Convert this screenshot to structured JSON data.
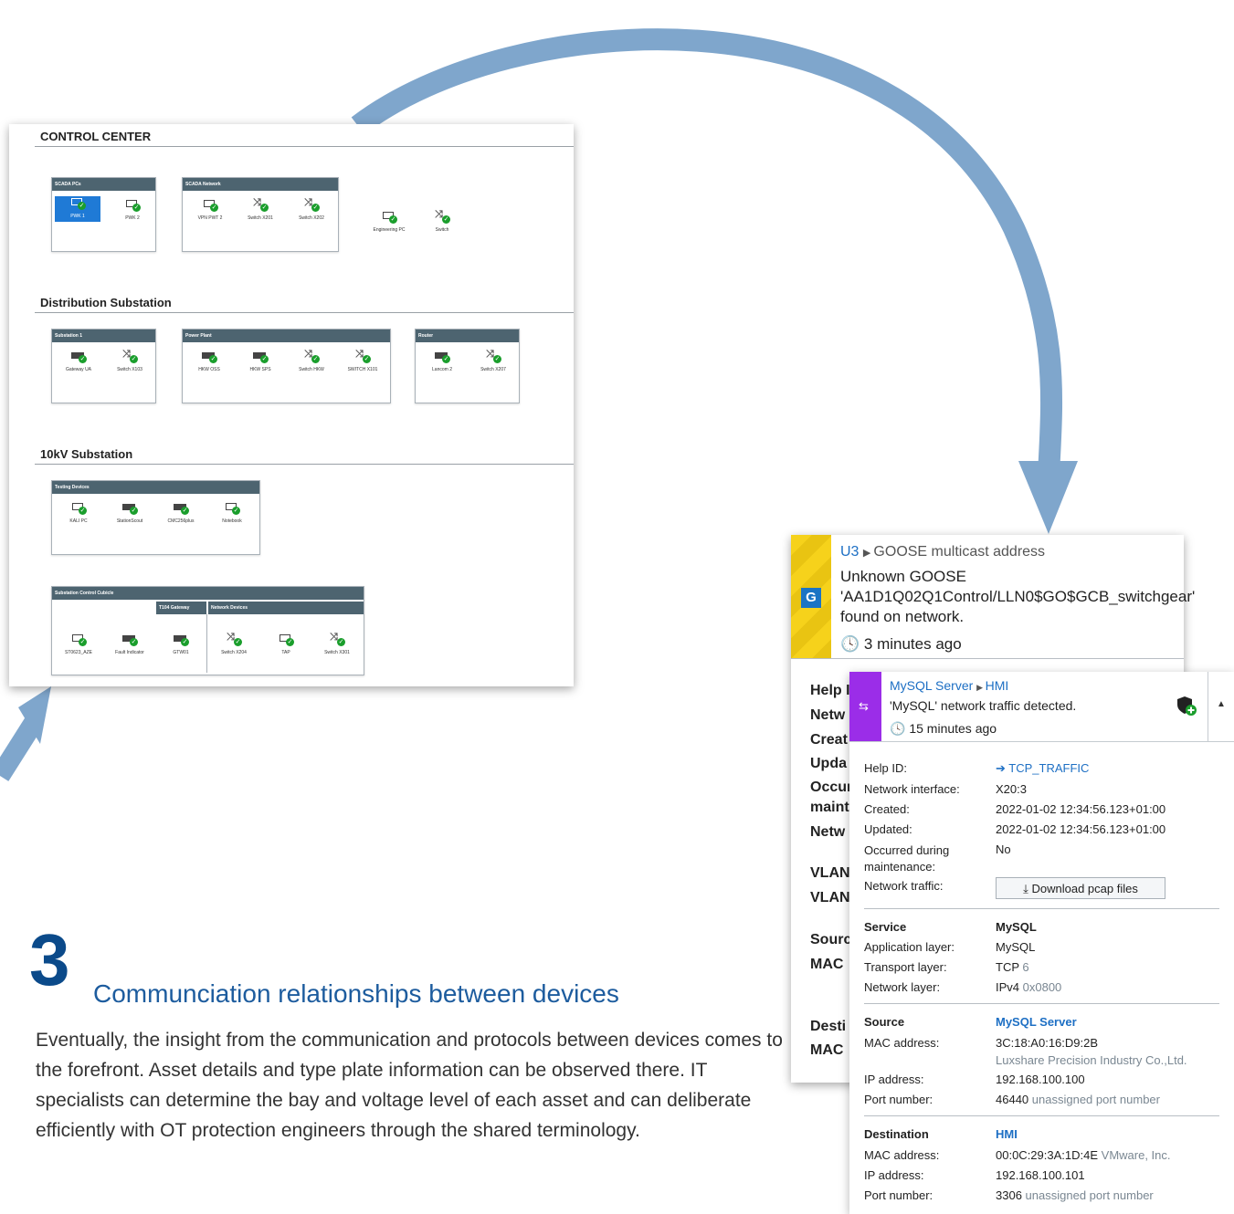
{
  "network": {
    "sections": {
      "control_center": "CONTROL CENTER",
      "distribution": "Distribution Substation",
      "kv10": "10kV Substation"
    },
    "groups": {
      "scada_pcs": "SCADA PCs",
      "scada_network": "SCADA Network",
      "substation1": "Substation 1",
      "power_plant": "Power Plant",
      "router": "Router",
      "testing": "Testing Devices",
      "cubicle": "Substation Control Cubicle",
      "t104": "T104 Gateway",
      "netdev": "Network Devices"
    },
    "devices": {
      "pwk1": "PWK 1",
      "pwk2": "PWK 2",
      "vpn": "VPN PWT 2",
      "sw201": "Switch X201",
      "sw202": "Switch X202",
      "eng": "Engineering PC",
      "switch": "Switch",
      "gateway": "Gateway UA",
      "sw103": "Switch X103",
      "hkwoss": "HKW OSS",
      "hkwsps": "HKW SPS",
      "swhkw": "Switch HKW",
      "sw101a": "SWITCH X101",
      "lancom": "Lancom 2",
      "sw207": "Switch X207",
      "kali": "KALI PC",
      "station": "StationScout",
      "cmc": "CMC256plus",
      "notebook": "Notebook",
      "st": "ST0623_AZE",
      "fault": "Fault Indicator",
      "gtw": "GTW01",
      "sw204": "Switch X204",
      "tap": "TAP",
      "sw301": "Switch X301"
    }
  },
  "heading": {
    "number": "3",
    "title": "Communciation relationships between devices",
    "body": "Eventually, the insight from the communication and protocols between devices comes to the forefront. Asset details and type plate information can be observed there. IT specialists can determine the bay and voltage level of each asset and can deliberate efficiently with OT protection engineers through the shared terminology."
  },
  "goose": {
    "badge": "G",
    "from": "U3",
    "to": "GOOSE multicast address",
    "title": "Unknown GOOSE",
    "message": "'AA1D1Q02Q1Control/LLN0$GO$GCB_switchgear'",
    "message2": "found on network.",
    "time": "3 minutes ago",
    "cut_labels": [
      "Help I",
      "Netw",
      "Creat",
      "Upda",
      "Occur",
      "maint",
      "Netw",
      "VLAN",
      "VLAN",
      "Sourc",
      "MAC",
      "Desti",
      "MAC"
    ]
  },
  "mysql": {
    "from": "MySQL Server",
    "to": "HMI",
    "message": "'MySQL' network traffic detected.",
    "time": "15 minutes ago",
    "help_id_label": "Help ID:",
    "help_id": "TCP_TRAFFIC",
    "netif_label": "Network interface:",
    "netif": "X20:3",
    "created_label": "Created:",
    "created": "2022-01-02 12:34:56.123+01:00",
    "updated_label": "Updated:",
    "updated": "2022-01-02 12:34:56.123+01:00",
    "maint_label": "Occurred during maintenance:",
    "maint": "No",
    "traffic_label": "Network traffic:",
    "download": "Download pcap files",
    "service_label": "Service",
    "service": "MySQL",
    "app_label": "Application layer:",
    "app": "MySQL",
    "transport_label": "Transport layer:",
    "transport": "TCP",
    "transport_num": "6",
    "network_label": "Network layer:",
    "network": "IPv4",
    "network_hex": "0x0800",
    "source_label": "Source",
    "source": "MySQL Server",
    "src_mac_label": "MAC address:",
    "src_mac": "3C:18:A0:16:D9:2B",
    "src_vendor": "Luxshare Precision Industry Co.,Ltd.",
    "src_ip_label": "IP address:",
    "src_ip": "192.168.100.100",
    "src_port_label": "Port number:",
    "src_port": "46440",
    "src_port_note": "unassigned port number",
    "dest_label": "Destination",
    "dest": "HMI",
    "dst_mac_label": "MAC address:",
    "dst_mac": "00:0C:29:3A:1D:4E",
    "dst_vendor": "VMware, Inc.",
    "dst_ip_label": "IP address:",
    "dst_ip": "192.168.100.101",
    "dst_port_label": "Port number:",
    "dst_port": "3306",
    "dst_port_note": "unassigned port number"
  }
}
